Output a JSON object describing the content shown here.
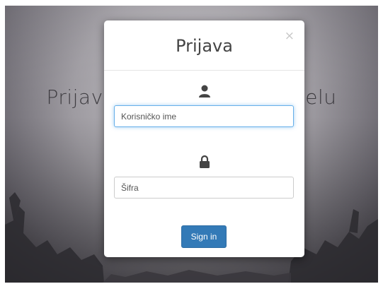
{
  "background": {
    "title": "Prijava za rezervaciju tabelu"
  },
  "modal": {
    "title": "Prijava",
    "close_icon": "×",
    "username": {
      "icon": "user-icon",
      "placeholder": "Korisničko ime",
      "value": ""
    },
    "password": {
      "icon": "lock-icon",
      "placeholder": "Šifra",
      "value": ""
    },
    "submit_label": "Sign in"
  },
  "colors": {
    "primary": "#337ab7",
    "focus_border": "#66afe9",
    "icon": "#444444"
  }
}
